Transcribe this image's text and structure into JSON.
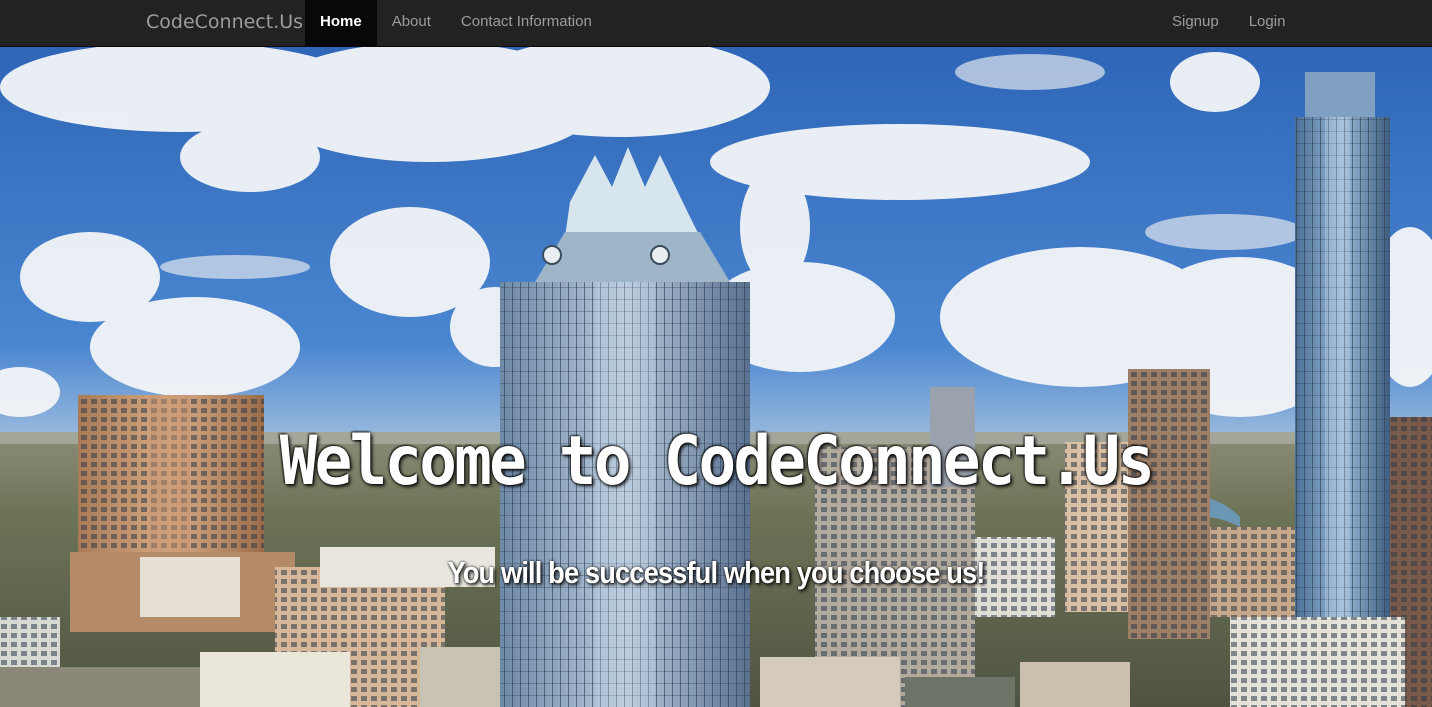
{
  "navbar": {
    "brand": "CodeConnect.Us",
    "left_links": [
      {
        "label": "Home",
        "active": true
      },
      {
        "label": "About",
        "active": false
      },
      {
        "label": "Contact Information",
        "active": false
      }
    ],
    "right_links": [
      {
        "label": "Signup"
      },
      {
        "label": "Login"
      }
    ]
  },
  "hero": {
    "headline": "Welcome to CodeConnect.Us",
    "subheadline": "You will be successful when you choose us!",
    "background_image": "city-skyline-with-clouds"
  },
  "colors": {
    "navbar_bg": "#222222",
    "nav_active_bg": "#080808",
    "nav_text": "#9d9d9d",
    "sky": "#3f7fd0"
  }
}
